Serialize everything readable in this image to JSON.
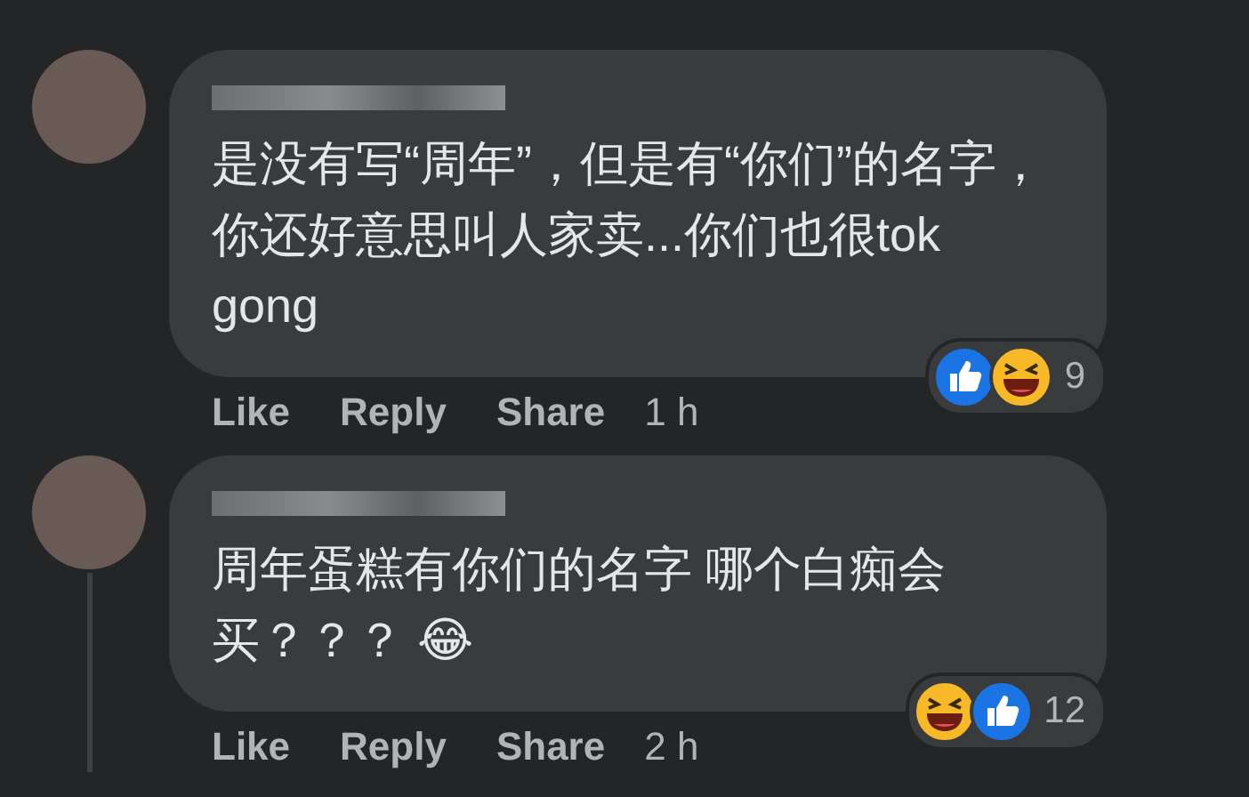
{
  "comments": [
    {
      "text": "是没有写“周年”，但是有“你们”的名字，你还好意思叫人家卖...你们也很tok gong",
      "reactions": [
        {
          "kind": "like"
        },
        {
          "kind": "haha"
        }
      ],
      "reaction_count": "9",
      "actions": [
        "Like",
        "Reply",
        "Share"
      ],
      "time": "1 h",
      "has_replies_line": false
    },
    {
      "text": "周年蛋糕有你们的名字 哪个白痴会买？？？ 😂",
      "reactions": [
        {
          "kind": "haha"
        },
        {
          "kind": "like"
        }
      ],
      "reaction_count": "12",
      "actions": [
        "Like",
        "Reply",
        "Share"
      ],
      "time": "2 h",
      "has_replies_line": true
    }
  ]
}
